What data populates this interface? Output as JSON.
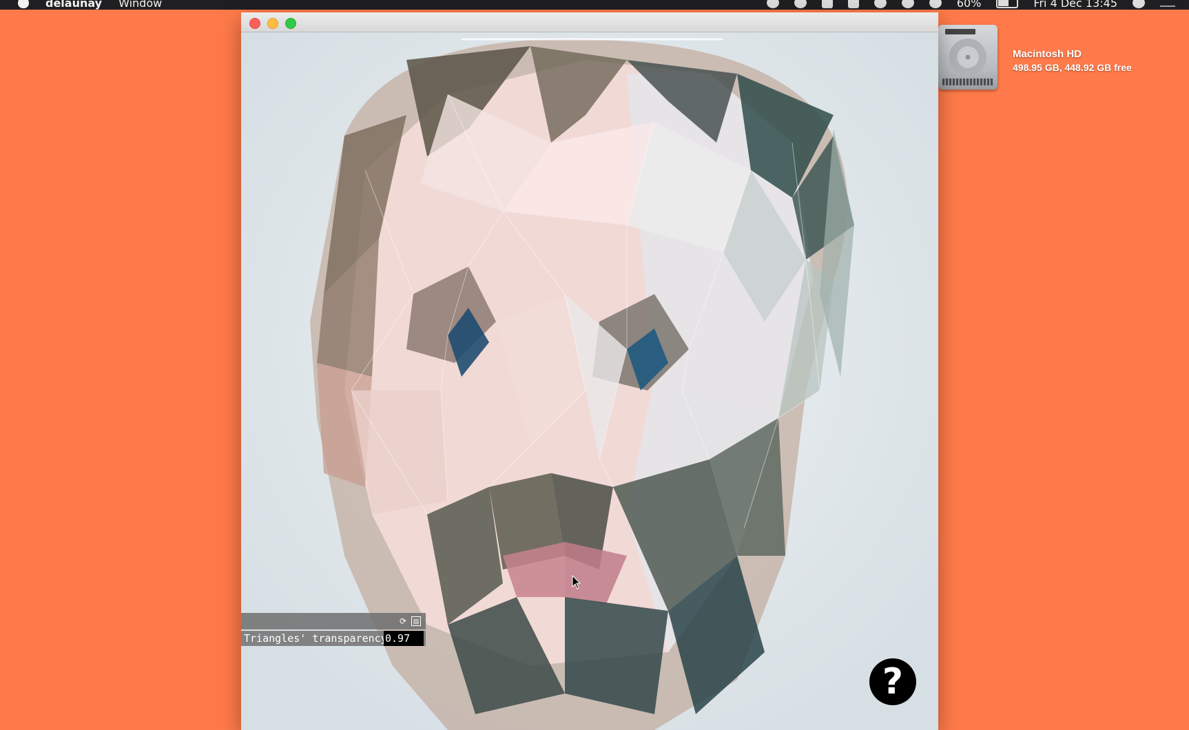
{
  "menubar": {
    "app_name": "delaunay",
    "menus": [
      "Window"
    ],
    "battery": "60%",
    "clock": "Fri 4 Dec  13:45",
    "status_icons": [
      "record-icon",
      "moon-icon",
      "dropbox-icon",
      "lock-icon",
      "headphones-icon",
      "time-machine-icon",
      "wifi-icon",
      "battery-icon",
      "search-icon",
      "notification-center-icon"
    ]
  },
  "desktop": {
    "drive_name": "Macintosh HD",
    "drive_info": "498.95 GB, 448.92 GB free"
  },
  "window": {
    "title": "",
    "gui": {
      "reset_icon": "⟳",
      "save_icon": "▤",
      "param_label": "Triangles' transparency",
      "param_value": "0.97"
    },
    "help_label": "?"
  },
  "colors": {
    "desktop_bg": "#ff7a4a",
    "menubar_bg": "#1f1f21",
    "help_bg": "#000000"
  }
}
